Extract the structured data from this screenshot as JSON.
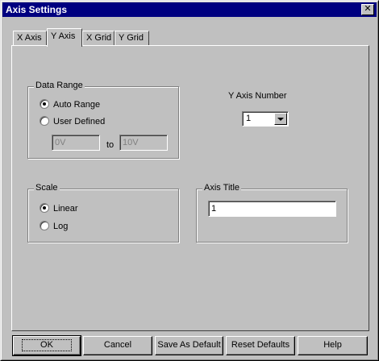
{
  "window": {
    "title": "Axis Settings",
    "close_glyph": "✕"
  },
  "tabs": [
    {
      "label": "X Axis",
      "active": false
    },
    {
      "label": "Y Axis",
      "active": true
    },
    {
      "label": "X Grid",
      "active": false
    },
    {
      "label": "Y Grid",
      "active": false
    }
  ],
  "data_range": {
    "title": "Data Range",
    "auto_range": {
      "label": "Auto Range",
      "checked": true
    },
    "user_defined": {
      "label": "User Defined",
      "checked": false
    },
    "from_value": "0V",
    "to_label": "to",
    "to_value": "10V"
  },
  "y_axis_number": {
    "label": "Y Axis Number",
    "value": "1"
  },
  "scale": {
    "title": "Scale",
    "linear": {
      "label": "Linear",
      "checked": true
    },
    "log": {
      "label": "Log",
      "checked": false
    }
  },
  "axis_title": {
    "title": "Axis Title",
    "value": "1"
  },
  "buttons": {
    "ok": "OK",
    "cancel": "Cancel",
    "save_default": "Save As Default",
    "reset_defaults": "Reset Defaults",
    "help": "Help"
  },
  "icons": {
    "close": "close-icon",
    "dropdown": "chevron-down-icon"
  },
  "colors": {
    "titlebar": "#000080",
    "face": "#c0c0c0"
  }
}
